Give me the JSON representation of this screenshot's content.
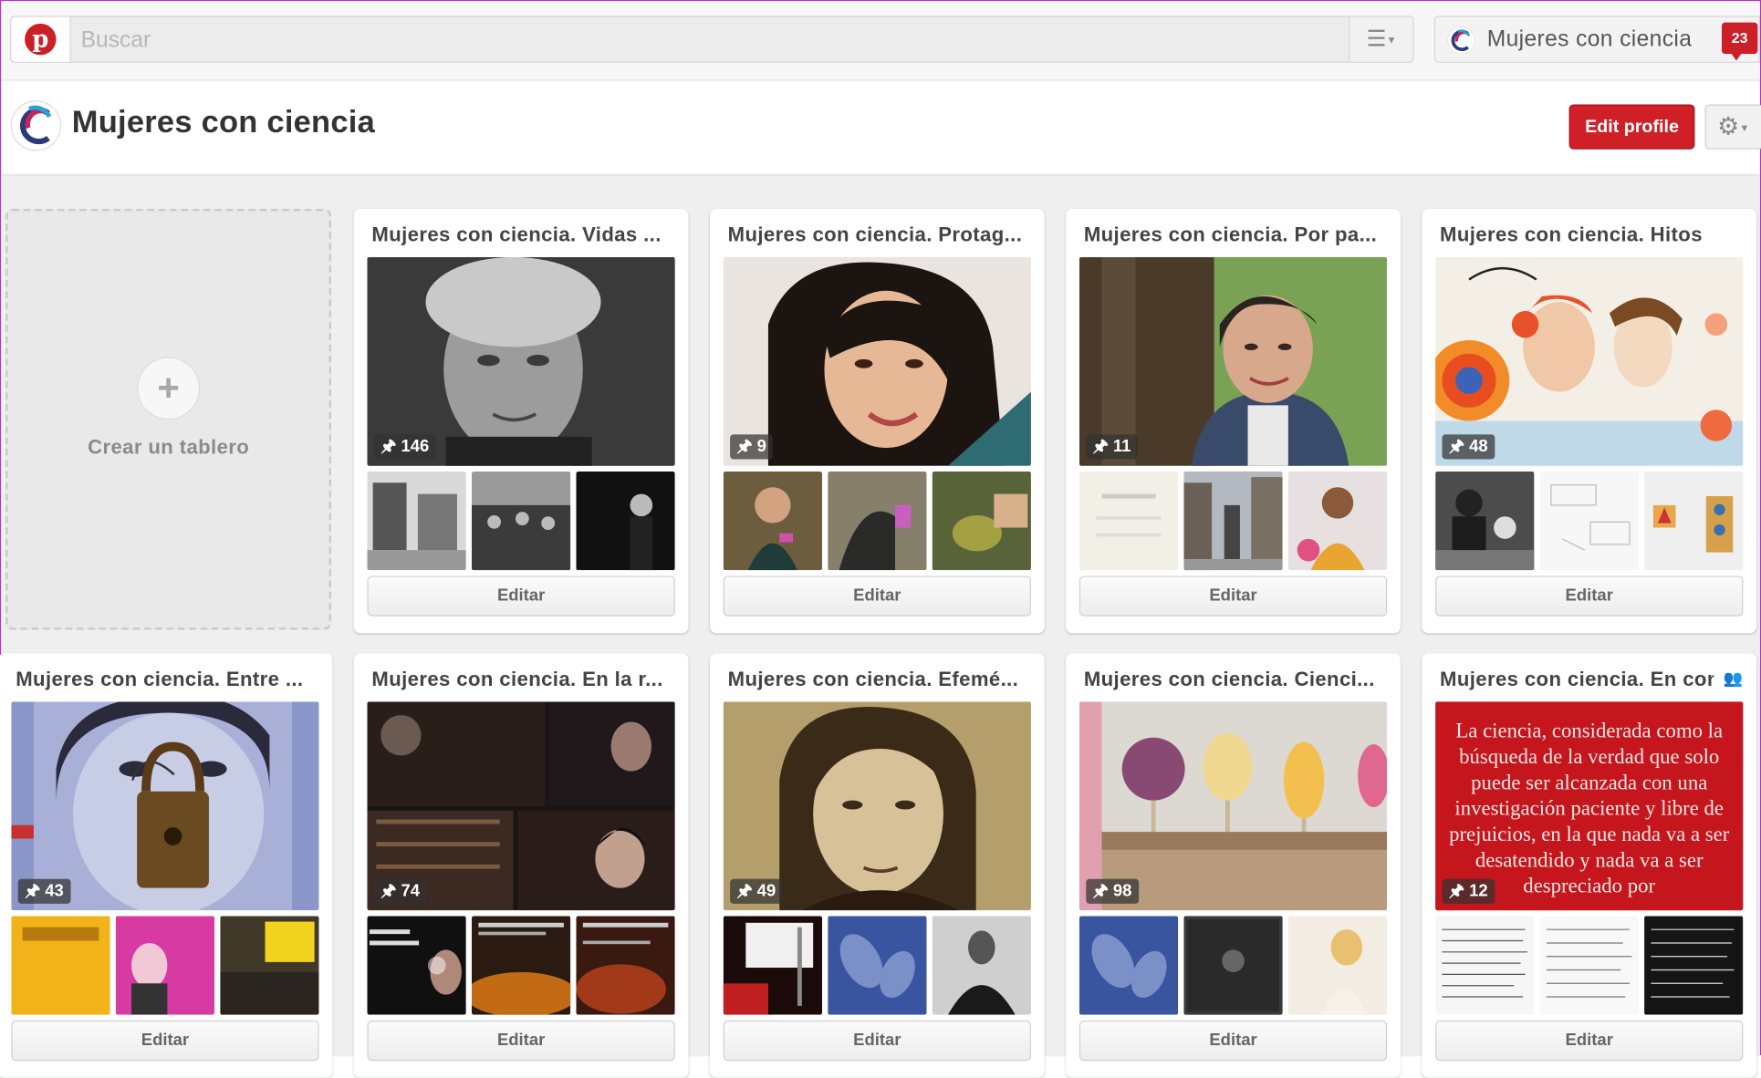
{
  "header": {
    "search_placeholder": "Buscar",
    "user_name": "Mujeres con ciencia",
    "notifications": "23"
  },
  "profile": {
    "name": "Mujeres con ciencia",
    "edit_profile_label": "Edit profile"
  },
  "create_board": {
    "label": "Crear un tablero"
  },
  "boards": [
    {
      "title": "Mujeres con ciencia. Vidas ...",
      "pins": "146",
      "edit": "Editar"
    },
    {
      "title": "Mujeres con ciencia. Protag...",
      "pins": "9",
      "edit": "Editar"
    },
    {
      "title": "Mujeres con ciencia. Por pa...",
      "pins": "11",
      "edit": "Editar"
    },
    {
      "title": "Mujeres con ciencia. Hitos",
      "pins": "48",
      "edit": "Editar"
    },
    {
      "title": "Mujeres con ciencia. Entre ...",
      "pins": "43",
      "edit": "Editar"
    },
    {
      "title": "Mujeres con ciencia. En la r...",
      "pins": "74",
      "edit": "Editar"
    },
    {
      "title": "Mujeres con ciencia. Efemé...",
      "pins": "49",
      "edit": "Editar"
    },
    {
      "title": "Mujeres con ciencia. Cienci...",
      "pins": "98",
      "edit": "Editar"
    },
    {
      "title": "Mujeres con ciencia. En con",
      "pins": "12",
      "edit": "Editar",
      "cover_text": "La ciencia, considerada como la búsqueda de la verdad que solo puede ser alcanzada con una investigación paciente y libre de prejuicios, en la que nada va a ser desatendido y nada va a ser despreciado por"
    }
  ],
  "colors": {
    "brand_red": "#cb2027",
    "board_bg": "#efefef"
  }
}
